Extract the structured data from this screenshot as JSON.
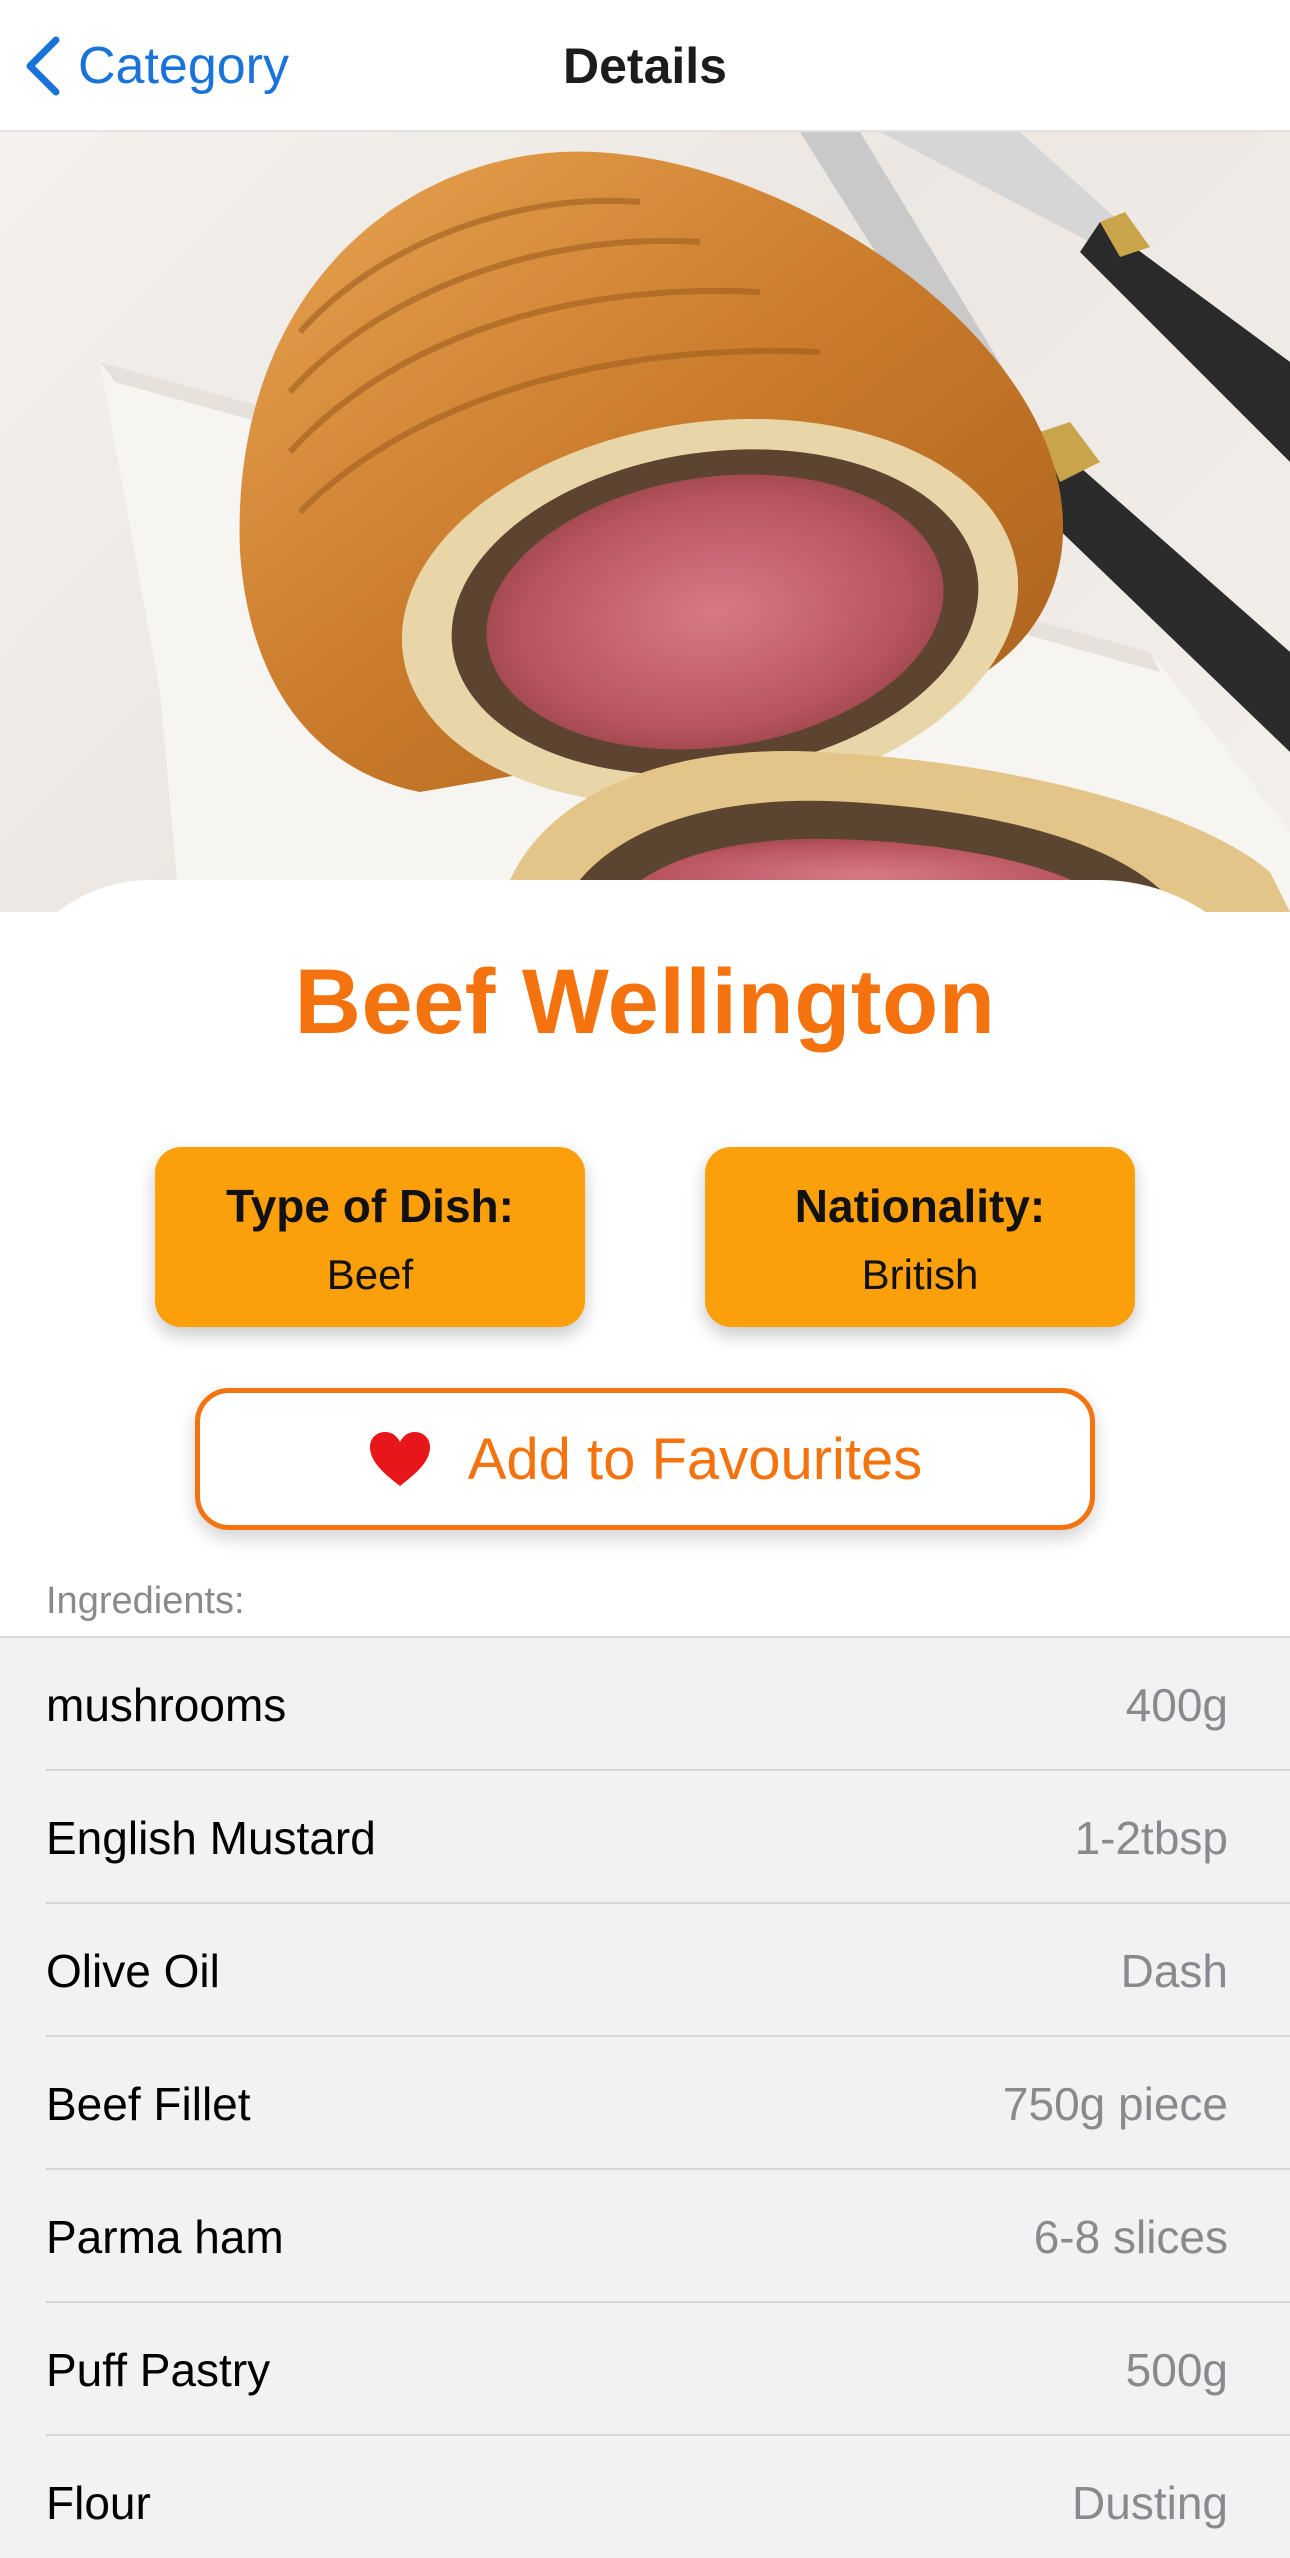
{
  "nav": {
    "back_label": "Category",
    "title": "Details"
  },
  "hero": {
    "image_description_icon": "food-photo"
  },
  "recipe": {
    "title": "Beef Wellington",
    "type_label": "Type of Dish:",
    "type_value": "Beef",
    "nationality_label": "Nationality:",
    "nationality_value": "British"
  },
  "favourite": {
    "label": "Add to Favourites",
    "icon": "heart-icon"
  },
  "ingredients": {
    "header": "Ingredients:",
    "items": [
      {
        "name": "mushrooms",
        "qty": "400g"
      },
      {
        "name": "English Mustard",
        "qty": "1-2tbsp"
      },
      {
        "name": "Olive Oil",
        "qty": "Dash"
      },
      {
        "name": "Beef Fillet",
        "qty": "750g piece"
      },
      {
        "name": "Parma ham",
        "qty": "6-8 slices"
      },
      {
        "name": "Puff Pastry",
        "qty": "500g"
      },
      {
        "name": "Flour",
        "qty": "Dusting"
      }
    ]
  },
  "colors": {
    "accent_orange": "#f5730f",
    "info_box": "#fba00b",
    "link_blue": "#1a73d9",
    "heart_red": "#e8151b"
  }
}
